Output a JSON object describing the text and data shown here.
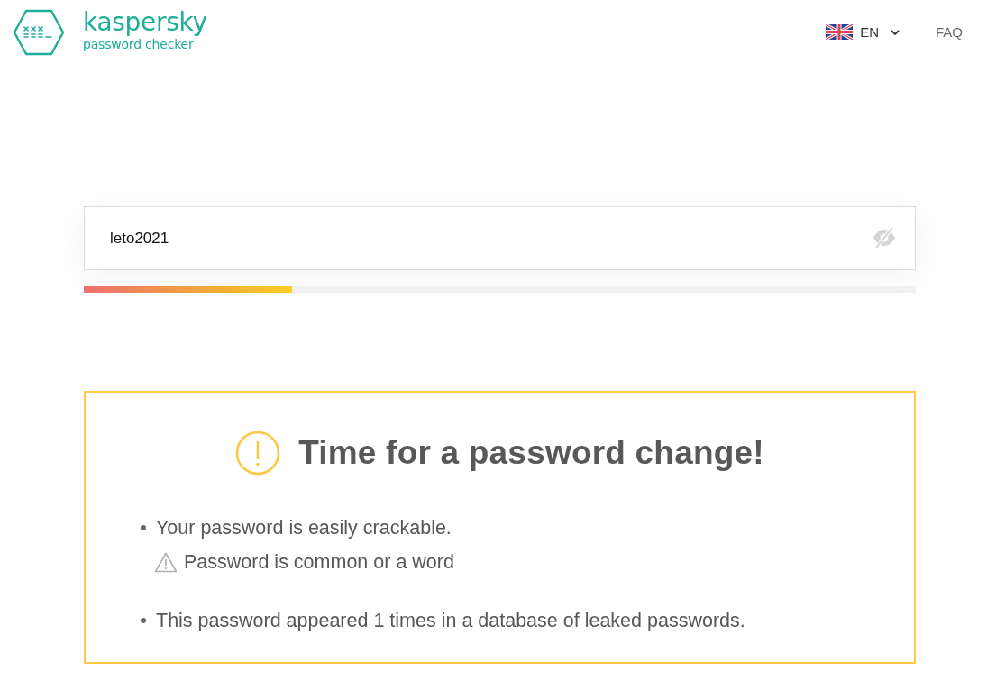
{
  "header": {
    "logo": {
      "brand": "kaspersky",
      "product": "password checker"
    },
    "language": {
      "code": "EN"
    },
    "faq_link": "FAQ"
  },
  "password_field": {
    "value": "leto2021"
  },
  "strength_meter": {
    "level": 0.25
  },
  "result": {
    "title": "Time for a password change!",
    "items": [
      {
        "text": "Your password is easily crackable.",
        "warnings": [
          "Password is common or a word"
        ]
      },
      {
        "text": "This password appeared 1 times in a database of leaked passwords."
      }
    ]
  }
}
